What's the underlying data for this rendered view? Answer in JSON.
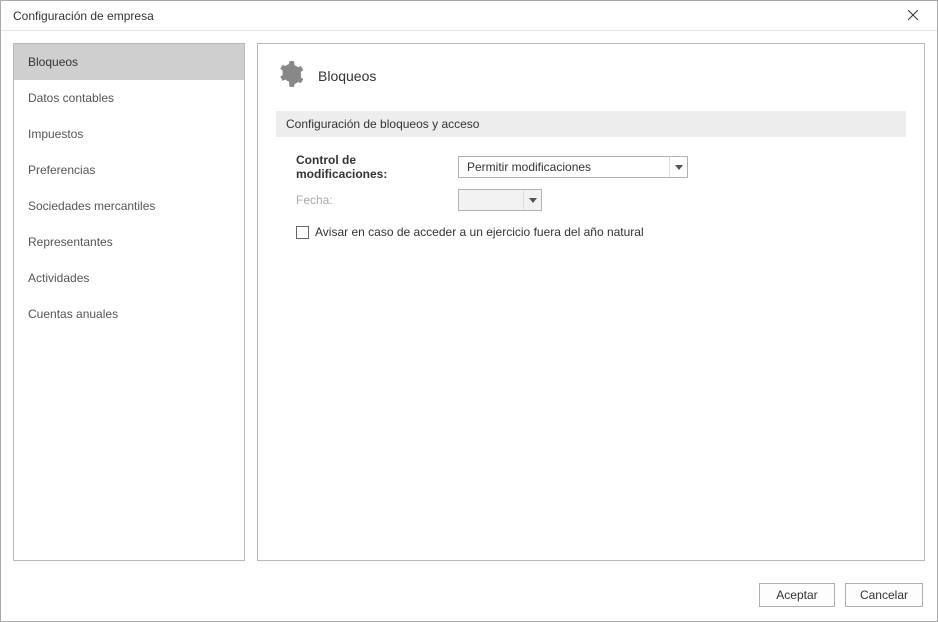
{
  "window": {
    "title": "Configuración de empresa"
  },
  "sidebar": {
    "items": [
      {
        "label": "Bloqueos",
        "active": true
      },
      {
        "label": "Datos contables",
        "active": false
      },
      {
        "label": "Impuestos",
        "active": false
      },
      {
        "label": "Preferencias",
        "active": false
      },
      {
        "label": "Sociedades mercantiles",
        "active": false
      },
      {
        "label": "Representantes",
        "active": false
      },
      {
        "label": "Actividades",
        "active": false
      },
      {
        "label": "Cuentas anuales",
        "active": false
      }
    ]
  },
  "panel": {
    "title": "Bloqueos",
    "section": "Configuración de bloqueos y acceso",
    "control_label": "Control de modificaciones:",
    "control_value": "Permitir modificaciones",
    "fecha_label": "Fecha:",
    "fecha_value": "",
    "checkbox_label": "Avisar en caso de acceder a un ejercicio fuera del año natural",
    "checkbox_checked": false
  },
  "footer": {
    "accept": "Aceptar",
    "cancel": "Cancelar"
  }
}
